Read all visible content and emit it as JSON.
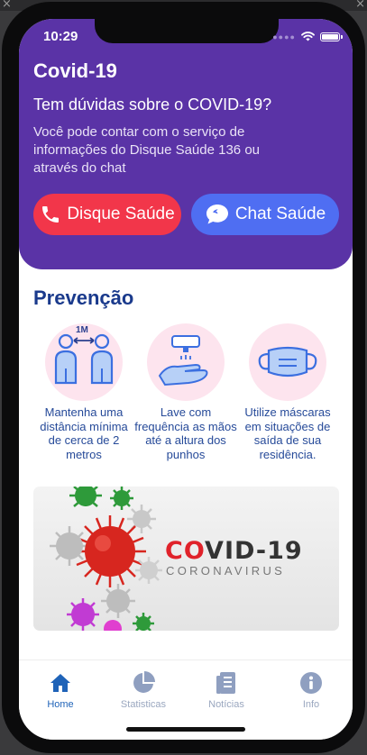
{
  "status_bar": {
    "time": "10:29"
  },
  "header": {
    "title": "Covid-19",
    "question": "Tem dúvidas sobre o COVID-19?",
    "description": "Você pode contar com o serviço de informações do Disque Saúde 136 ou através do chat",
    "phone_button_label": "Disque Saúde",
    "chat_button_label": "Chat Saúde"
  },
  "prevention": {
    "title": "Prevenção",
    "items": [
      {
        "icon": "social-distance-icon",
        "icon_label": "1M",
        "text": "Mantenha uma distância mínima de cerca de 2 metros"
      },
      {
        "icon": "hand-wash-icon",
        "text": "Lave com frequência as mãos até a altura dos punhos"
      },
      {
        "icon": "face-mask-icon",
        "text": "Utilize máscaras em situações de saída de sua residência."
      }
    ]
  },
  "banner": {
    "title_red": "CO",
    "title_rest": "VID-19",
    "subtitle": "CORONAVIRUS"
  },
  "tabs": [
    {
      "label": "Home",
      "icon": "home-icon",
      "active": true
    },
    {
      "label": "Statisticas",
      "icon": "pie-chart-icon",
      "active": false
    },
    {
      "label": "Notícias",
      "icon": "news-icon",
      "active": false
    },
    {
      "label": "Info",
      "icon": "info-icon",
      "active": false
    }
  ],
  "colors": {
    "header_bg": "#5a33a6",
    "phone_button": "#f2364a",
    "chat_button": "#4f6ef2",
    "section_title": "#1a3a8c",
    "tab_active": "#1f63b8",
    "tab_inactive": "#9aa7bf"
  }
}
